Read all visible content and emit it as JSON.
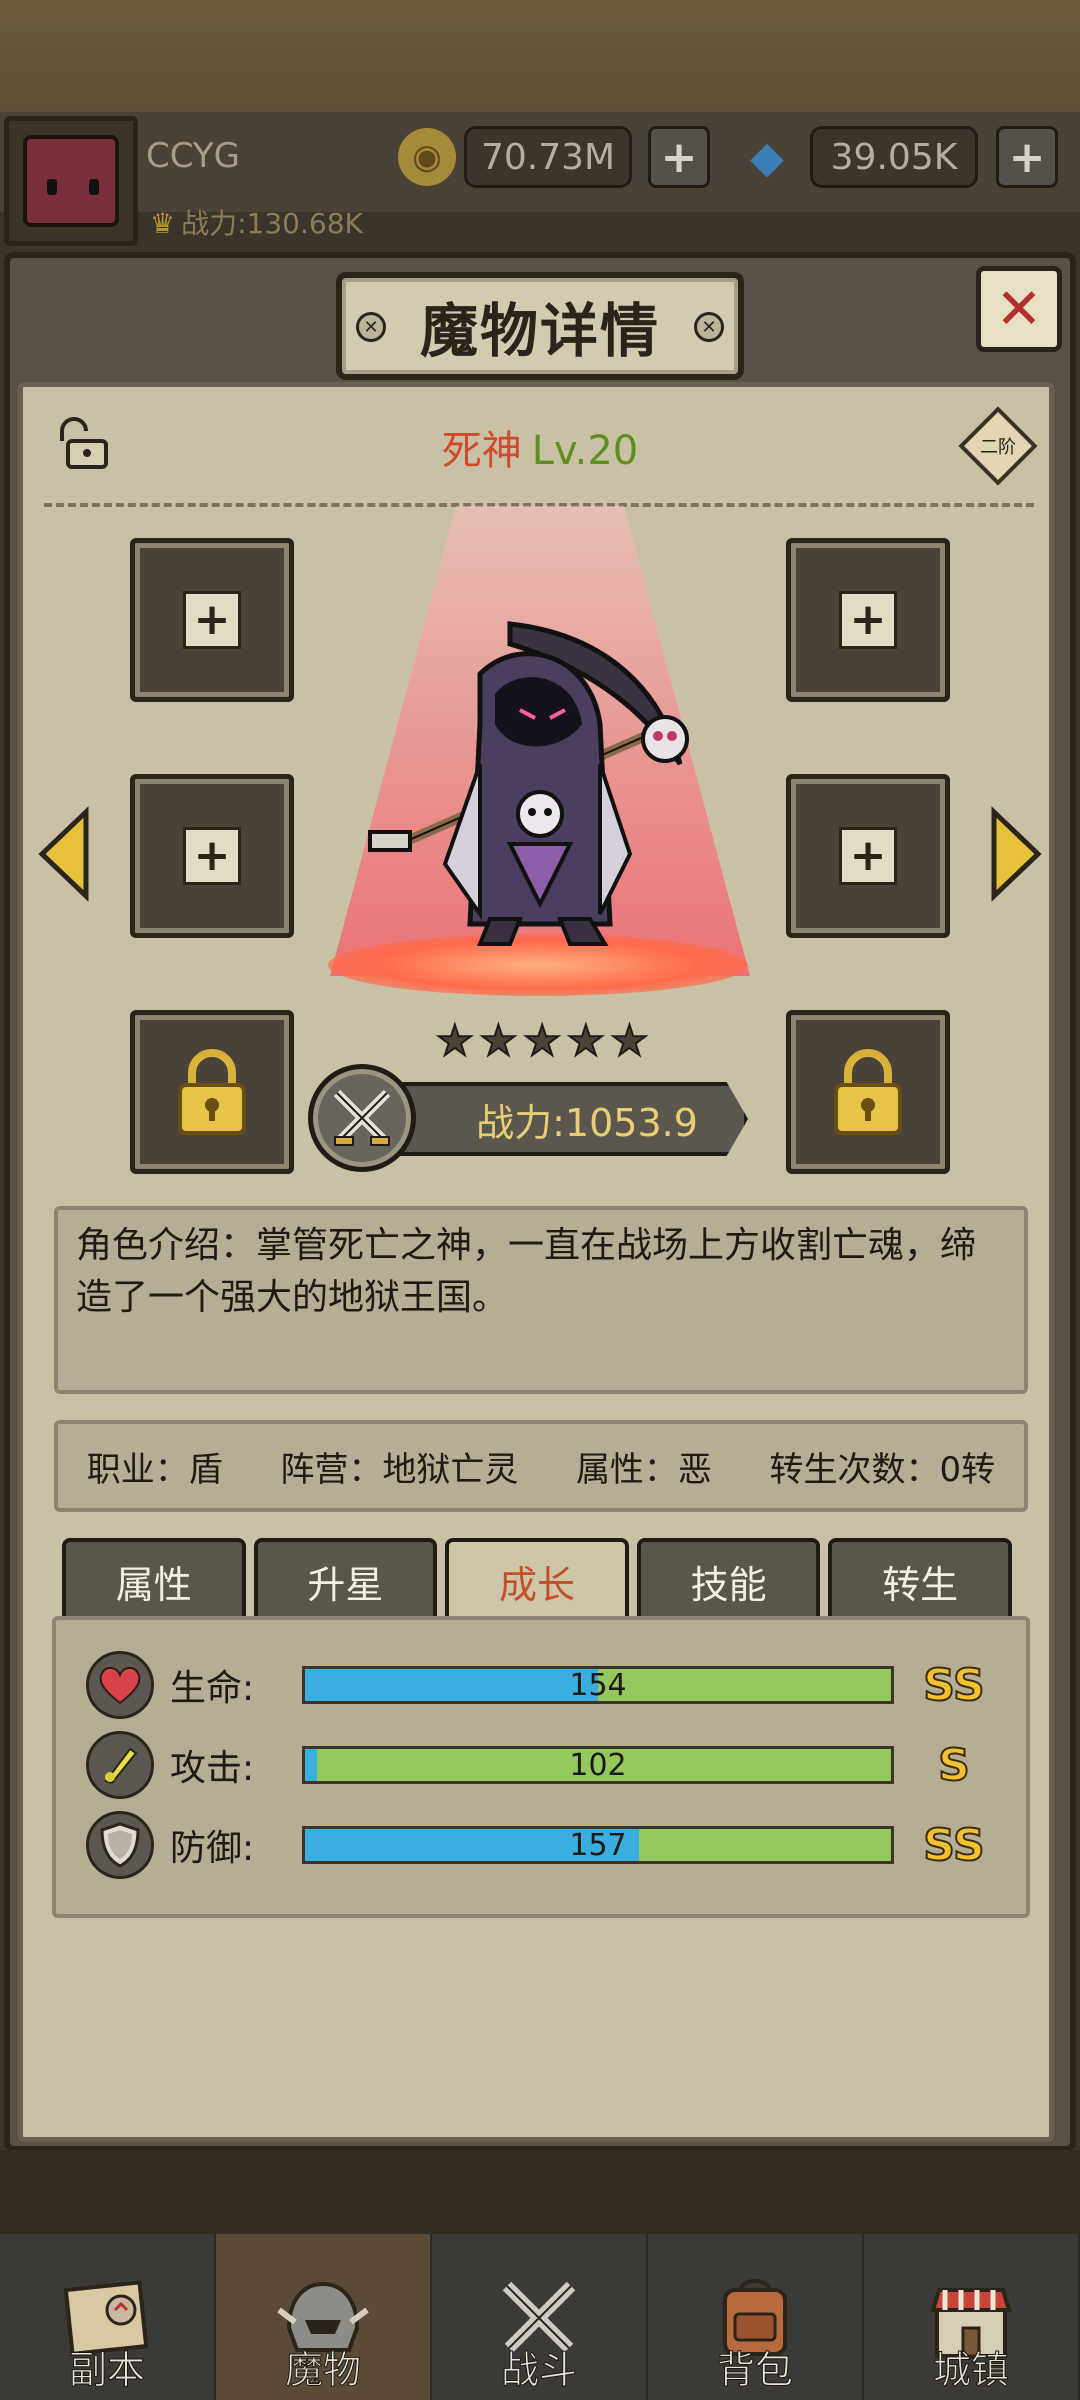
{
  "topbar": {
    "player_name": "CCYG",
    "power_label": "战力:130.68K",
    "gold": "70.73M",
    "gems": "39.05K",
    "gold_icon": "coin-icon",
    "gem_icon": "diamond-icon"
  },
  "panel": {
    "title": "魔物详情",
    "close_label": "✕",
    "rank_badge": "二阶"
  },
  "monster": {
    "name": "死神",
    "level": "Lv.20",
    "stars": 5,
    "power_label": "战力:1053.9",
    "description": "角色介绍：掌管死亡之神，一直在战场上方收割亡魂，缔造了一个强大的地狱王国。"
  },
  "info": {
    "class": "职业：盾",
    "faction": "阵营：地狱亡灵",
    "attribute": "属性：恶",
    "rebirth": "转生次数：0转"
  },
  "tabs": [
    {
      "label": "属性"
    },
    {
      "label": "升星"
    },
    {
      "label": "成长",
      "active": true
    },
    {
      "label": "技能"
    },
    {
      "label": "转生"
    }
  ],
  "stats": [
    {
      "label": "生命:",
      "value": "154",
      "fill": 0.5,
      "grade": "SS",
      "icon": "heart-icon"
    },
    {
      "label": "攻击:",
      "value": "102",
      "fill": 0.02,
      "grade": "S",
      "icon": "attack-icon"
    },
    {
      "label": "防御:",
      "value": "157",
      "fill": 0.57,
      "grade": "SS",
      "icon": "shield-icon"
    }
  ],
  "nav": [
    {
      "label": "副本",
      "icon": "map-icon"
    },
    {
      "label": "魔物",
      "icon": "helmet-icon",
      "active": true
    },
    {
      "label": "战斗",
      "icon": "swords-icon"
    },
    {
      "label": "背包",
      "icon": "backpack-icon"
    },
    {
      "label": "城镇",
      "icon": "town-icon"
    }
  ],
  "colors": {
    "name_red": "#d24a2e",
    "level_green": "#5f8f1e",
    "bar_blue": "#3aaede",
    "bar_green": "#93c95c",
    "grade_gold": "#f3c22e"
  }
}
